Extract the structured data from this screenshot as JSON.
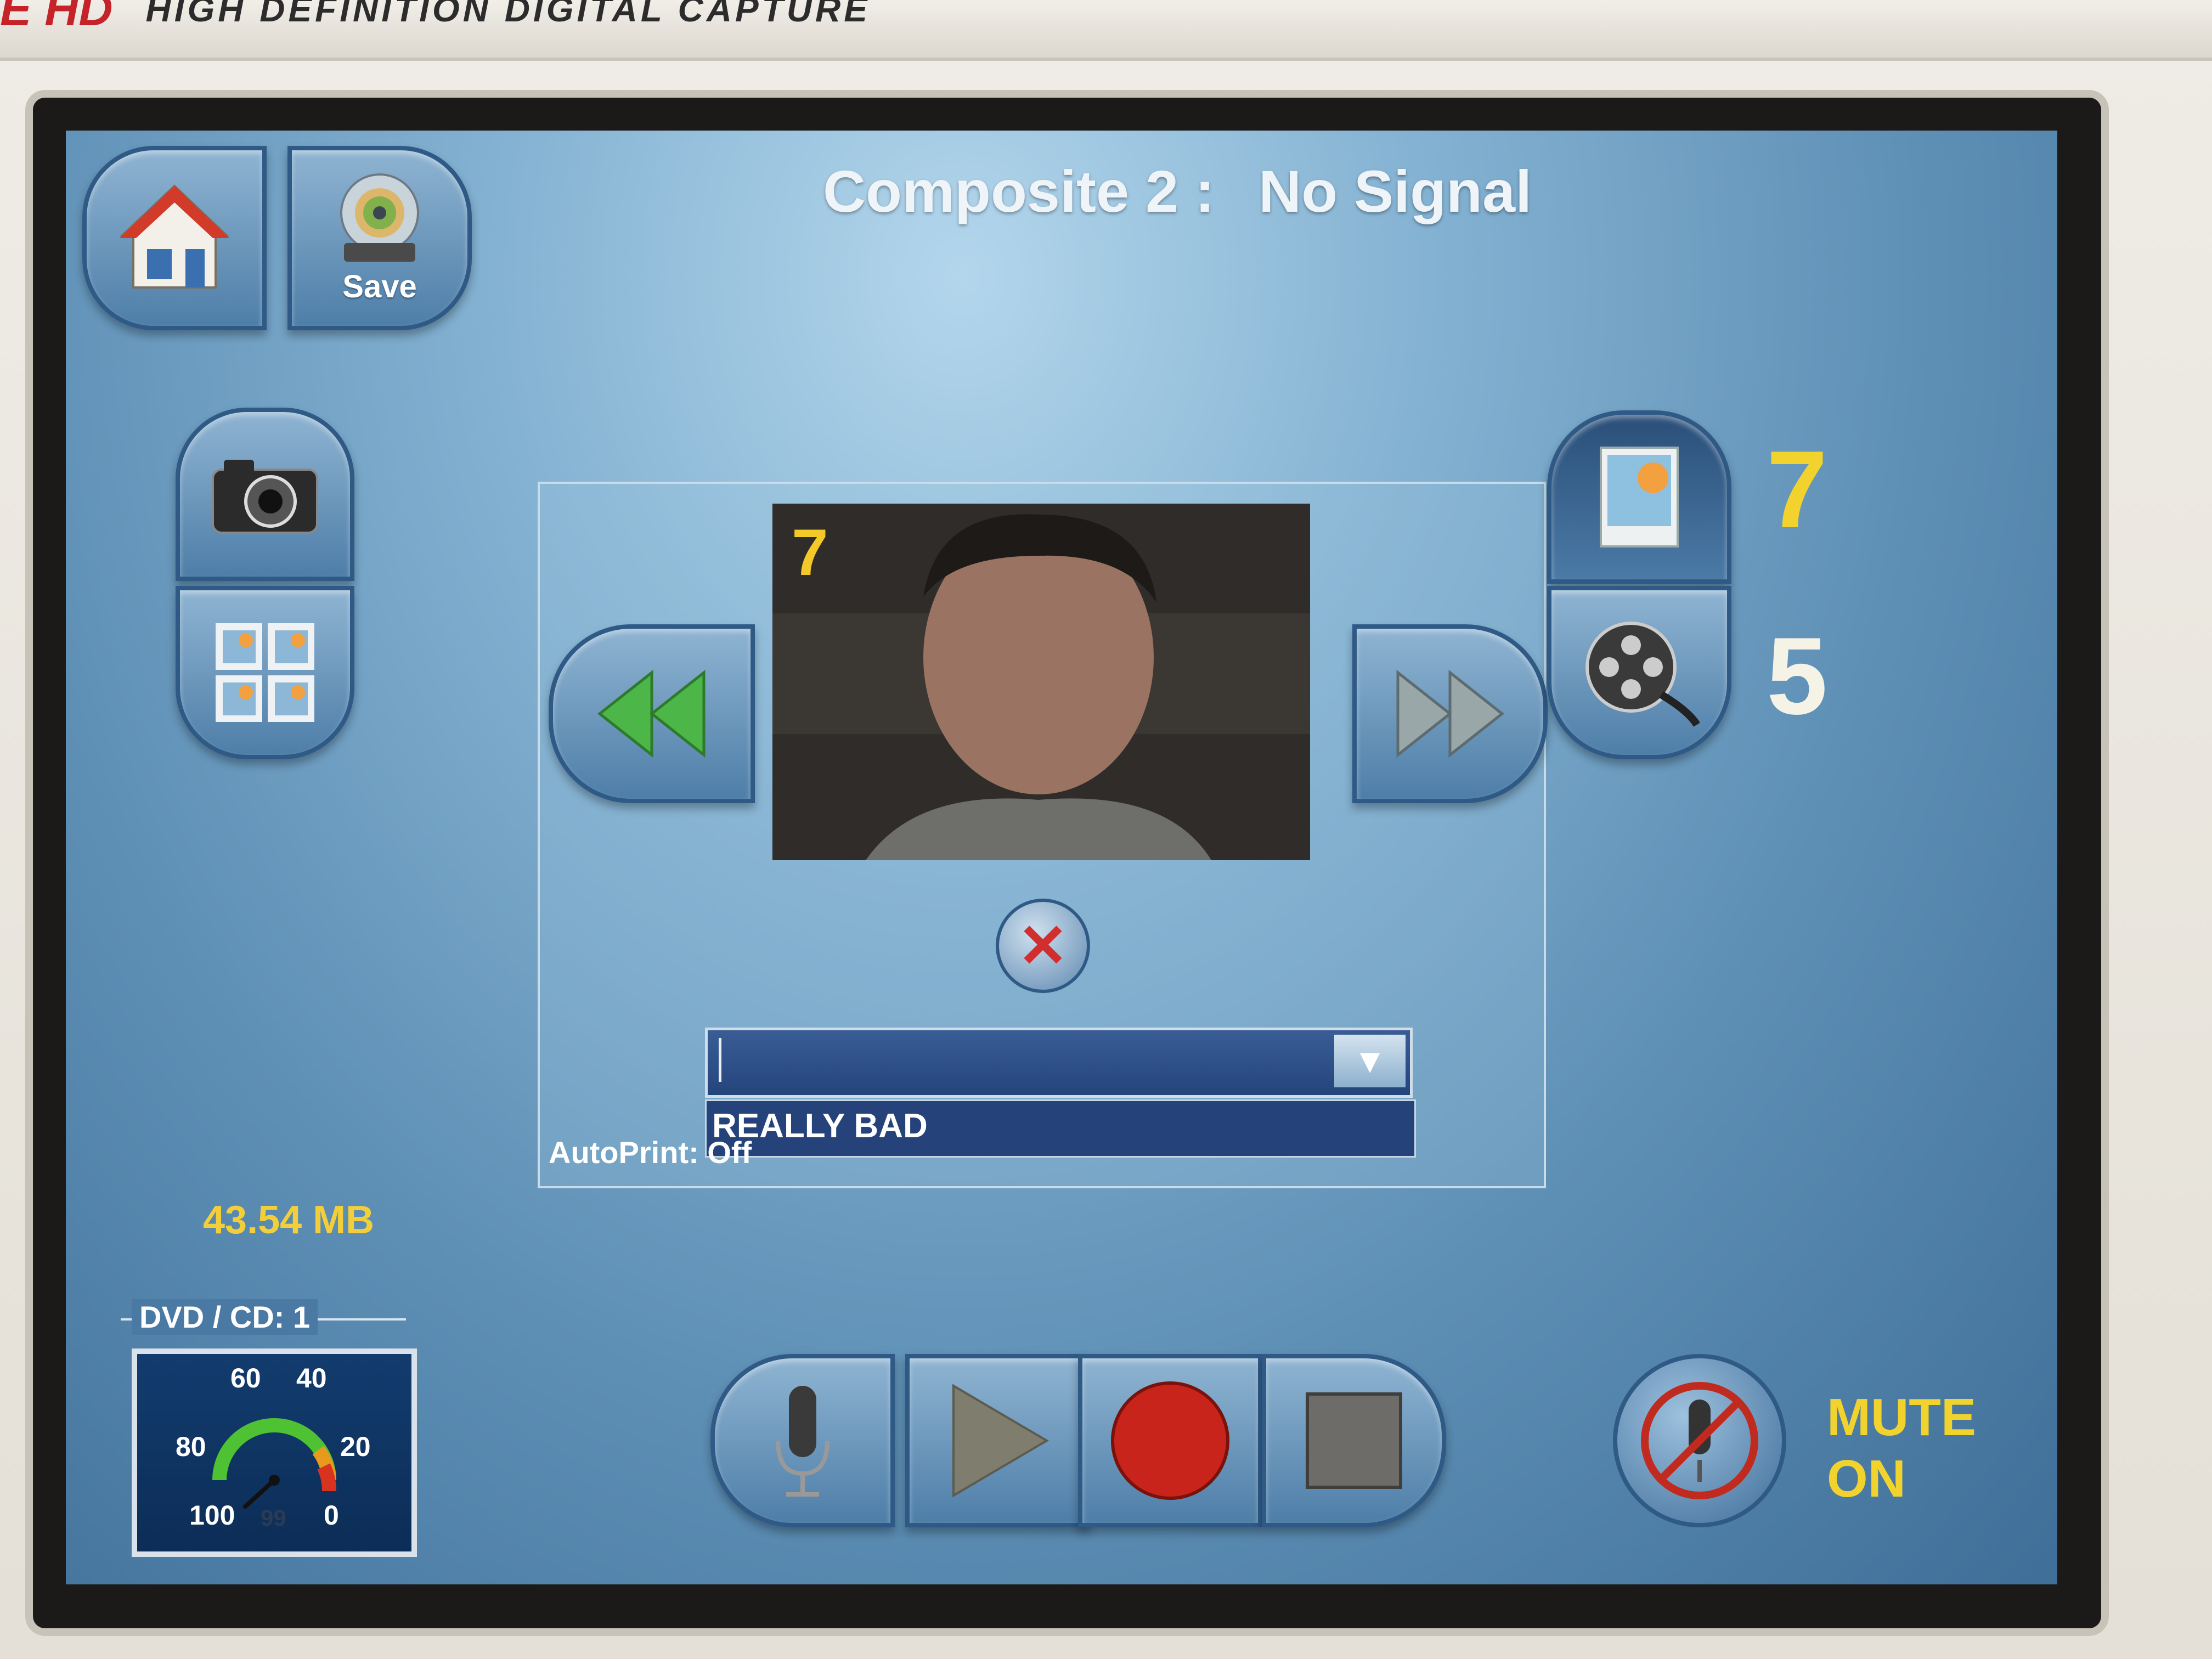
{
  "device": {
    "brand_mark": "E HD",
    "brand_subtitle": "HIGH DEFINITION DIGITAL CAPTURE"
  },
  "header": {
    "source": "Composite 2 :",
    "status": "No Signal"
  },
  "toolbar": {
    "home_icon": "home-icon",
    "save_label": "Save",
    "save_icon": "disc-icon"
  },
  "capture": {
    "camera_icon": "camera-icon",
    "gallery_icon": "gallery-icon"
  },
  "viewer": {
    "image_number": "7",
    "rewind_icon": "rewind-icon",
    "forward_icon": "fast-forward-icon",
    "delete_icon": "close-icon"
  },
  "annotation": {
    "current_value": "",
    "options": [
      "REALLY BAD"
    ],
    "autoprint_label": "AutoPrint: Off"
  },
  "counts": {
    "photos": "7",
    "videos": "5",
    "photo_icon": "picture-icon",
    "video_icon": "film-reel-icon"
  },
  "storage": {
    "used": "43.54 MB",
    "dvd_label": "DVD / CD: 1",
    "gauge_ticks": [
      "60",
      "40",
      "80",
      "20",
      "100",
      "0"
    ],
    "gauge_value": "99",
    "gauge_level": 99
  },
  "transport": {
    "mic_icon": "microphone-icon",
    "play_icon": "play-icon",
    "record_icon": "record-icon",
    "stop_icon": "stop-icon"
  },
  "audio": {
    "mute_icon": "muted-microphone-icon",
    "mute_line1": "MUTE",
    "mute_line2": "ON"
  },
  "colors": {
    "screen_blue": "#5e8fb5",
    "accent_yellow": "#f2d32e",
    "record_red": "#c8241b",
    "brand_red": "#c5222a"
  }
}
